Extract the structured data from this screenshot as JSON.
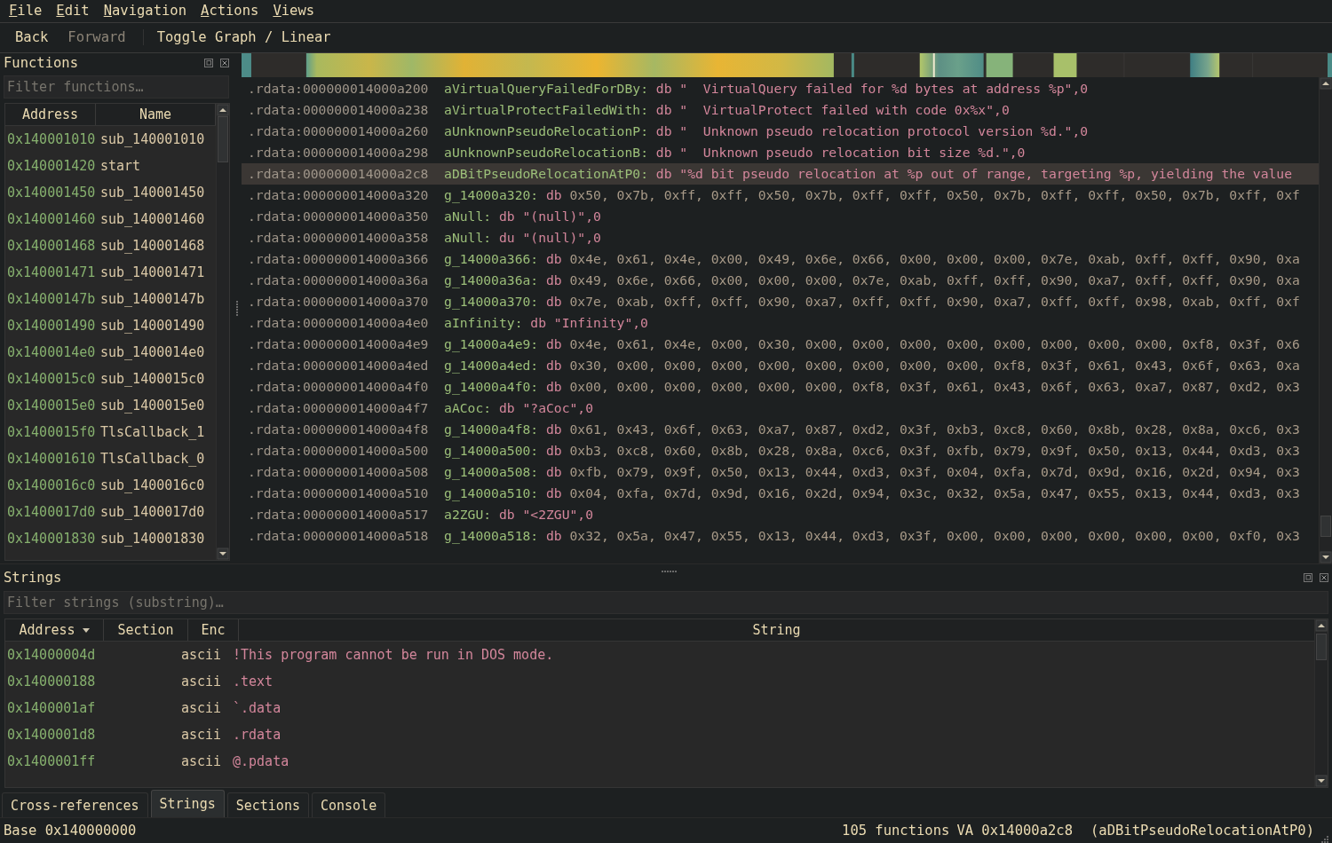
{
  "menu": [
    {
      "label": "File"
    },
    {
      "label": "Edit"
    },
    {
      "label": "Navigation"
    },
    {
      "label": "Actions"
    },
    {
      "label": "Views"
    }
  ],
  "toolbar": [
    {
      "label": "Back",
      "disabled": false
    },
    {
      "label": "Forward",
      "disabled": true
    },
    {
      "label": "Toggle Graph / Linear",
      "disabled": false
    }
  ],
  "functions_panel": {
    "title": "Functions",
    "filter": {
      "placeholder": "Filter functions…"
    },
    "columns": [
      "Address",
      "Name"
    ],
    "rows": [
      {
        "address": "0x140001010",
        "name": "sub_140001010"
      },
      {
        "address": "0x140001420",
        "name": "start"
      },
      {
        "address": "0x140001450",
        "name": "sub_140001450"
      },
      {
        "address": "0x140001460",
        "name": "sub_140001460"
      },
      {
        "address": "0x140001468",
        "name": "sub_140001468"
      },
      {
        "address": "0x140001471",
        "name": "sub_140001471"
      },
      {
        "address": "0x14000147b",
        "name": "sub_14000147b"
      },
      {
        "address": "0x140001490",
        "name": "sub_140001490"
      },
      {
        "address": "0x1400014e0",
        "name": "sub_1400014e0"
      },
      {
        "address": "0x1400015c0",
        "name": "sub_1400015c0"
      },
      {
        "address": "0x1400015e0",
        "name": "sub_1400015e0"
      },
      {
        "address": "0x1400015f0",
        "name": "TlsCallback_1"
      },
      {
        "address": "0x140001610",
        "name": "TlsCallback_0"
      },
      {
        "address": "0x1400016c0",
        "name": "sub_1400016c0"
      },
      {
        "address": "0x1400017d0",
        "name": "sub_1400017d0"
      },
      {
        "address": "0x140001830",
        "name": "sub_140001830"
      }
    ]
  },
  "listing": {
    "lines": [
      {
        "address": ".rdata:000000014000a200",
        "label": "aVirtualQueryFailedForDBy:",
        "directive": "db",
        "operand": "\"  VirtualQuery failed for %d bytes at address %p\",0",
        "kind": "string",
        "selected": false
      },
      {
        "address": ".rdata:000000014000a238",
        "label": "aVirtualProtectFailedWith:",
        "directive": "db",
        "operand": "\"  VirtualProtect failed with code 0x%x\",0",
        "kind": "string",
        "selected": false
      },
      {
        "address": ".rdata:000000014000a260",
        "label": "aUnknownPseudoRelocationP:",
        "directive": "db",
        "operand": "\"  Unknown pseudo relocation protocol version %d.\",0",
        "kind": "string",
        "selected": false
      },
      {
        "address": ".rdata:000000014000a298",
        "label": "aUnknownPseudoRelocationB:",
        "directive": "db",
        "operand": "\"  Unknown pseudo relocation bit size %d.\",0",
        "kind": "string",
        "selected": false
      },
      {
        "address": ".rdata:000000014000a2c8",
        "label": "aDBitPseudoRelocationAtP0:",
        "directive": "db",
        "operand": "\"%d bit pseudo relocation at %p out of range, targeting %p, yielding the value",
        "kind": "string",
        "selected": true
      },
      {
        "address": ".rdata:000000014000a320",
        "label": "g_14000a320:",
        "directive": "db",
        "operand": "0x50, 0x7b, 0xff, 0xff, 0x50, 0x7b, 0xff, 0xff, 0x50, 0x7b, 0xff, 0xff, 0x50, 0x7b, 0xff, 0xf",
        "kind": "bytes",
        "selected": false
      },
      {
        "address": ".rdata:000000014000a350",
        "label": "aNull:",
        "directive": "db",
        "operand": "\"(null)\",0",
        "kind": "string",
        "selected": false
      },
      {
        "address": ".rdata:000000014000a358",
        "label": "aNull:",
        "directive": "du",
        "operand": "\"(null)\",0",
        "kind": "string",
        "selected": false
      },
      {
        "address": ".rdata:000000014000a366",
        "label": "g_14000a366:",
        "directive": "db",
        "operand": "0x4e, 0x61, 0x4e, 0x00, 0x49, 0x6e, 0x66, 0x00, 0x00, 0x00, 0x7e, 0xab, 0xff, 0xff, 0x90, 0xa",
        "kind": "bytes",
        "selected": false
      },
      {
        "address": ".rdata:000000014000a36a",
        "label": "g_14000a36a:",
        "directive": "db",
        "operand": "0x49, 0x6e, 0x66, 0x00, 0x00, 0x00, 0x7e, 0xab, 0xff, 0xff, 0x90, 0xa7, 0xff, 0xff, 0x90, 0xa",
        "kind": "bytes",
        "selected": false
      },
      {
        "address": ".rdata:000000014000a370",
        "label": "g_14000a370:",
        "directive": "db",
        "operand": "0x7e, 0xab, 0xff, 0xff, 0x90, 0xa7, 0xff, 0xff, 0x90, 0xa7, 0xff, 0xff, 0x98, 0xab, 0xff, 0xf",
        "kind": "bytes",
        "selected": false
      },
      {
        "address": ".rdata:000000014000a4e0",
        "label": "aInfinity:",
        "directive": "db",
        "operand": "\"Infinity\",0",
        "kind": "string",
        "selected": false
      },
      {
        "address": ".rdata:000000014000a4e9",
        "label": "g_14000a4e9:",
        "directive": "db",
        "operand": "0x4e, 0x61, 0x4e, 0x00, 0x30, 0x00, 0x00, 0x00, 0x00, 0x00, 0x00, 0x00, 0x00, 0xf8, 0x3f, 0x6",
        "kind": "bytes",
        "selected": false
      },
      {
        "address": ".rdata:000000014000a4ed",
        "label": "g_14000a4ed:",
        "directive": "db",
        "operand": "0x30, 0x00, 0x00, 0x00, 0x00, 0x00, 0x00, 0x00, 0x00, 0xf8, 0x3f, 0x61, 0x43, 0x6f, 0x63, 0xa",
        "kind": "bytes",
        "selected": false
      },
      {
        "address": ".rdata:000000014000a4f0",
        "label": "g_14000a4f0:",
        "directive": "db",
        "operand": "0x00, 0x00, 0x00, 0x00, 0x00, 0x00, 0xf8, 0x3f, 0x61, 0x43, 0x6f, 0x63, 0xa7, 0x87, 0xd2, 0x3",
        "kind": "bytes",
        "selected": false
      },
      {
        "address": ".rdata:000000014000a4f7",
        "label": "aACoc:",
        "directive": "db",
        "operand": "\"?aCoc\",0",
        "kind": "string",
        "selected": false
      },
      {
        "address": ".rdata:000000014000a4f8",
        "label": "g_14000a4f8:",
        "directive": "db",
        "operand": "0x61, 0x43, 0x6f, 0x63, 0xa7, 0x87, 0xd2, 0x3f, 0xb3, 0xc8, 0x60, 0x8b, 0x28, 0x8a, 0xc6, 0x3",
        "kind": "bytes",
        "selected": false
      },
      {
        "address": ".rdata:000000014000a500",
        "label": "g_14000a500:",
        "directive": "db",
        "operand": "0xb3, 0xc8, 0x60, 0x8b, 0x28, 0x8a, 0xc6, 0x3f, 0xfb, 0x79, 0x9f, 0x50, 0x13, 0x44, 0xd3, 0x3",
        "kind": "bytes",
        "selected": false
      },
      {
        "address": ".rdata:000000014000a508",
        "label": "g_14000a508:",
        "directive": "db",
        "operand": "0xfb, 0x79, 0x9f, 0x50, 0x13, 0x44, 0xd3, 0x3f, 0x04, 0xfa, 0x7d, 0x9d, 0x16, 0x2d, 0x94, 0x3",
        "kind": "bytes",
        "selected": false
      },
      {
        "address": ".rdata:000000014000a510",
        "label": "g_14000a510:",
        "directive": "db",
        "operand": "0x04, 0xfa, 0x7d, 0x9d, 0x16, 0x2d, 0x94, 0x3c, 0x32, 0x5a, 0x47, 0x55, 0x13, 0x44, 0xd3, 0x3",
        "kind": "bytes",
        "selected": false
      },
      {
        "address": ".rdata:000000014000a517",
        "label": "a2ZGU:",
        "directive": "db",
        "operand": "\"<2ZGU\",0",
        "kind": "string",
        "selected": false
      },
      {
        "address": ".rdata:000000014000a518",
        "label": "g_14000a518:",
        "directive": "db",
        "operand": "0x32, 0x5a, 0x47, 0x55, 0x13, 0x44, 0xd3, 0x3f, 0x00, 0x00, 0x00, 0x00, 0x00, 0x00, 0xf0, 0x3",
        "kind": "bytes",
        "selected": false
      }
    ]
  },
  "strings_panel": {
    "title": "Strings",
    "filter": {
      "placeholder": "Filter strings (substring)…"
    },
    "columns": [
      {
        "label": "Address",
        "sorted": true
      },
      {
        "label": "Section",
        "sorted": false
      },
      {
        "label": "Enc",
        "sorted": false
      },
      {
        "label": "String",
        "sorted": false
      }
    ],
    "rows": [
      {
        "address": "0x14000004d",
        "enc": "ascii",
        "string": "!This program cannot be run in DOS mode."
      },
      {
        "address": "0x140000188",
        "enc": "ascii",
        "string": ".text"
      },
      {
        "address": "0x1400001af",
        "enc": "ascii",
        "string": "`.data"
      },
      {
        "address": "0x1400001d8",
        "enc": "ascii",
        "string": ".rdata"
      },
      {
        "address": "0x1400001ff",
        "enc": "ascii",
        "string": "@.pdata"
      }
    ]
  },
  "bottom_tabs": [
    {
      "label": "Cross-references",
      "selected": false
    },
    {
      "label": "Strings",
      "selected": true
    },
    {
      "label": "Sections",
      "selected": false
    },
    {
      "label": "Console",
      "selected": false
    }
  ],
  "status_bar": {
    "base": "Base 0x140000000",
    "function_count": "105 functions",
    "va": "VA 0x14000a2c8",
    "symbol": "(aDBitPseudoRelocationAtP0)"
  }
}
